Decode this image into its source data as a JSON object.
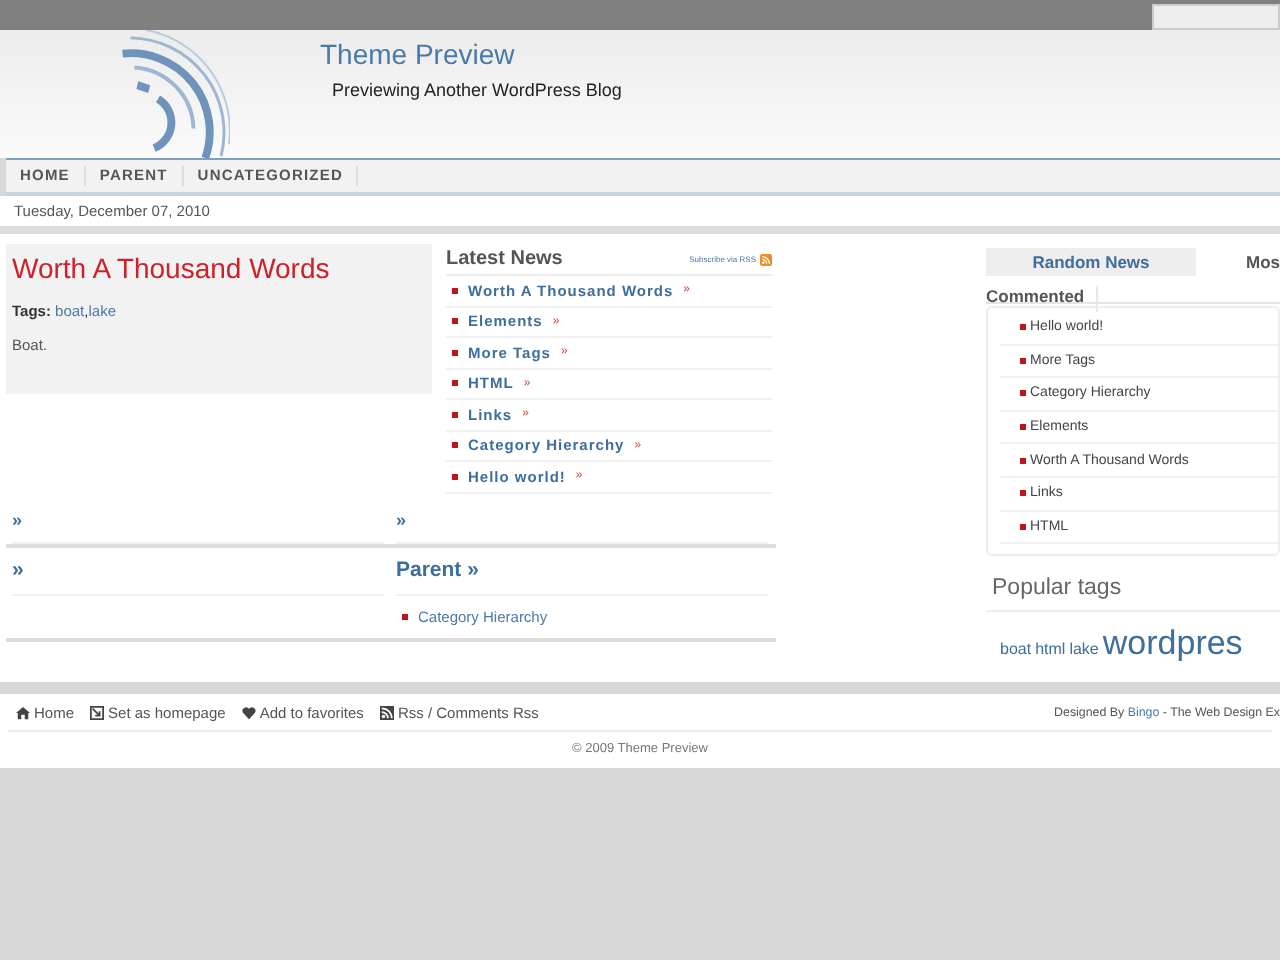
{
  "header": {
    "title": "Theme Preview",
    "tagline": "Previewing Another WordPress Blog"
  },
  "nav": {
    "items": [
      {
        "label": "HOME"
      },
      {
        "label": "PARENT"
      },
      {
        "label": "UNCATEGORIZED"
      }
    ]
  },
  "date": "Tuesday, December 07, 2010",
  "featured": {
    "title": "Worth A Thousand Words",
    "tags_label": "Tags:",
    "tags": [
      {
        "label": "boat",
        "separator": ","
      },
      {
        "label": "lake"
      }
    ],
    "excerpt": "Boat."
  },
  "latest_news": {
    "title": "Latest News",
    "subscribe": "Subscribe via RSS",
    "items": [
      {
        "title": "Worth A Thousand Words",
        "more": "»"
      },
      {
        "title": "Elements",
        "more": "»"
      },
      {
        "title": "More Tags",
        "more": "»"
      },
      {
        "title": "HTML",
        "more": "»"
      },
      {
        "title": "Links",
        "more": "»"
      },
      {
        "title": "Category Hierarchy",
        "more": "»"
      },
      {
        "title": "Hello world!",
        "more": "»"
      }
    ]
  },
  "category_rows": [
    [
      {
        "title": "»"
      },
      {
        "title": "»"
      }
    ],
    [
      {
        "title": "»"
      },
      {
        "title": "Parent »",
        "links": [
          "Category Hierarchy"
        ]
      }
    ]
  ],
  "sidebar": {
    "tabs": [
      {
        "label": "Random News",
        "selected": false
      },
      {
        "label": "Mos",
        "selected": true
      }
    ],
    "tab_overflow": "Commented",
    "items": [
      "Hello world!",
      "More Tags",
      "Category Hierarchy",
      "Elements",
      "Worth A Thousand Words",
      "Links",
      "HTML"
    ],
    "popular_tags": {
      "title": "Popular tags",
      "tags": [
        {
          "label": "boat",
          "kind": "small"
        },
        {
          "label": "html",
          "kind": "small"
        },
        {
          "label": "lake",
          "kind": "small"
        },
        {
          "label": "wordpres",
          "kind": "large"
        }
      ]
    }
  },
  "footer": {
    "links": [
      {
        "label": "Home",
        "kind": "home"
      },
      {
        "label": "Set as homepage",
        "kind": "homepage"
      },
      {
        "label": "Add to favorites",
        "kind": "favorite"
      },
      {
        "label": "Rss / Comments Rss",
        "kind": "rss"
      }
    ],
    "credit_prefix": "Designed By",
    "credit_link": "Bingo",
    "credit_suffix": "- The Web Design Ex",
    "copyright": "© 2009 Theme Preview"
  }
}
